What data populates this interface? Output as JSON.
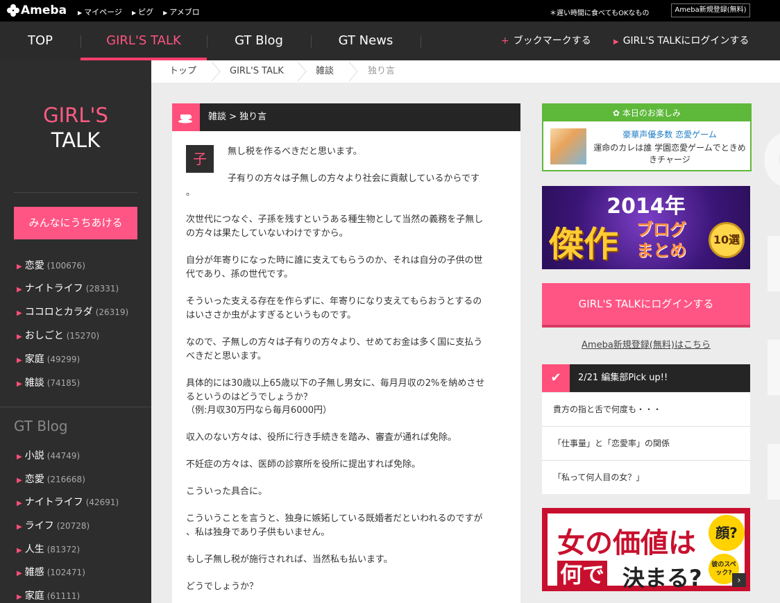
{
  "topbar": {
    "logo": "Ameba",
    "links": [
      "マイページ",
      "ピグ",
      "アメブロ"
    ],
    "note": "＊遅い時間に食べてもOKなもの",
    "register": "Ameba新規登録(無料)"
  },
  "nav": {
    "tabs": [
      "TOP",
      "GIRL'S TALK",
      "GT Blog",
      "GT News"
    ],
    "active": "GIRL'S TALK",
    "bookmark": "ブックマークする",
    "login": "GIRL'S TALKにログインする"
  },
  "sidebar": {
    "logo_line1": "GIRL'S",
    "logo_line2": "TALK",
    "cta": "みんなにうちあける",
    "categories": [
      {
        "label": "恋愛",
        "count": "(100676)"
      },
      {
        "label": "ナイトライフ",
        "count": "(28331)"
      },
      {
        "label": "ココロとカラダ",
        "count": "(26319)"
      },
      {
        "label": "おしごと",
        "count": "(15270)"
      },
      {
        "label": "家庭",
        "count": "(49299)"
      },
      {
        "label": "雑談",
        "count": "(74185)"
      }
    ],
    "blog_heading": "GT Blog",
    "blog_categories": [
      {
        "label": "小説",
        "count": "(44749)"
      },
      {
        "label": "恋愛",
        "count": "(216668)"
      },
      {
        "label": "ナイトライフ",
        "count": "(42691)"
      },
      {
        "label": "ライフ",
        "count": "(20728)"
      },
      {
        "label": "人生",
        "count": "(81372)"
      },
      {
        "label": "雑感",
        "count": "(102471)"
      },
      {
        "label": "家庭",
        "count": "(61111)"
      }
    ]
  },
  "breadcrumb": [
    "トップ",
    "GIRL'S TALK",
    "雑談",
    "独り言"
  ],
  "article": {
    "header": "雑談 > 独り言",
    "avatar_char": "子",
    "paragraphs": [
      "無し税を作るべきだと思います。",
      "子有りの方々は子無しの方々より社会に貢献しているからです",
      "。",
      "次世代につなぐ、子孫を残すというある種生物として当然の義務を子無し",
      "の方々は果たしていないわけですから。",
      "自分が年寄りになった時に誰に支えてもらうのか、それは自分の子供の世",
      "代であり、孫の世代です。",
      "そういった支える存在を作らずに、年寄りになり支えてもらおうとするの",
      "はいささか虫がよすぎるというものです。",
      "なので、子無しの方々は子有りの方々より、せめてお金は多く国に支払う",
      "べきだと思います。",
      "具体的には30歳以上65歳以下の子無し男女に、毎月月収の2%を納めさせ",
      "るというのはどうでしょうか？",
      "（例:月収30万円なら毎月6000円）",
      "収入のない方々は、役所に行き手続きを踏み、審査が通れば免除。",
      "不妊症の方々は、医師の診察所を役所に提出すれば免除。",
      "こういった具合に。",
      "こういうことを言うと、独身に嫉妬している既婚者だといわれるのですが",
      "、私は独身であり子供もいません。",
      "もし子無し税が施行されれば、当然私も払います。",
      "どうでしょうか？"
    ]
  },
  "today": {
    "heading": "本日のお楽しみ",
    "title": "豪華声優多数 恋愛ゲーム",
    "desc": "運命のカレは誰 学園恋愛ゲームでときめきチャージ"
  },
  "banner2014": {
    "year": "2014年",
    "main": "傑作",
    "sub1": "ブログ",
    "sub2": "まとめ",
    "badge": "10選"
  },
  "login_button": "GIRL'S TALKにログインする",
  "register_link": "Ameba新規登録(無料)はこちら",
  "pickup": {
    "title": "2/21 編集部Pick up!!",
    "items": [
      "貴方の指と舌で何度も・・・",
      "「仕事量」と「恋愛率」の関係",
      "「私って何人目の女？」"
    ]
  },
  "banner_onna": {
    "line1": "女の価値は",
    "line2a": "何で",
    "line2b": "決まる?",
    "badge1": "顔?",
    "badge2": "彼のスペック?"
  },
  "colors": {
    "accent": "#ff5584",
    "dark": "#2b2b2b",
    "green": "#5eb83a"
  }
}
